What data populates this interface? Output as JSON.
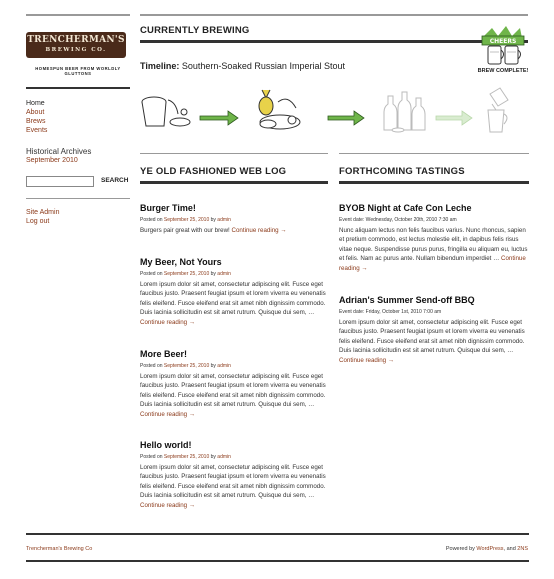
{
  "brand": {
    "name_line1": "TRENCHERMAN'S",
    "name_line2": "BREWING CO.",
    "tagline": "HOMESPUN BEER FROM WORLDLY GLUTTONS"
  },
  "nav": {
    "items": [
      "Home",
      "About",
      "Brews",
      "Events"
    ]
  },
  "archives": {
    "title": "Historical Archives",
    "link": "September 2010"
  },
  "search": {
    "value": "",
    "button_label": "SEARCH"
  },
  "meta": {
    "links": [
      "Site Admin",
      "Log out"
    ]
  },
  "current": {
    "heading": "CURRENTLY BREWING",
    "timeline_label": "Timeline:",
    "timeline_value": "Southern-Soaked Russian Imperial Stout",
    "cheers_text": "CHEERS",
    "complete_label": "BREW COMPLETE!"
  },
  "weblog": {
    "heading": "YE OLD FASHIONED WEB LOG",
    "posts": [
      {
        "title": "Burger Time!",
        "meta_prefix": "Posted on",
        "date": "September 25, 2010",
        "meta_by": "by",
        "author": "admin",
        "body": "Burgers pair great with our brew!",
        "more": "Continue reading →"
      },
      {
        "title": "My Beer, Not Yours",
        "meta_prefix": "Posted on",
        "date": "September 25, 2010",
        "meta_by": "by",
        "author": "admin",
        "body": "Lorem ipsum dolor sit amet, consectetur adipiscing elit. Fusce eget faucibus justo. Praesent feugiat ipsum et lorem viverra eu venenatis felis eleifend. Fusce eleifend erat sit amet nibh dignissim commodo. Duis lacinia sollicitudin est sit amet rutrum. Quisque dui sem, …",
        "more": "Continue reading →"
      },
      {
        "title": "More Beer!",
        "meta_prefix": "Posted on",
        "date": "September 25, 2010",
        "meta_by": "by",
        "author": "admin",
        "body": "Lorem ipsum dolor sit amet, consectetur adipiscing elit. Fusce eget faucibus justo. Praesent feugiat ipsum et lorem viverra eu venenatis felis eleifend. Fusce eleifend erat sit amet nibh dignissim commodo. Duis lacinia sollicitudin est sit amet rutrum. Quisque dui sem, …",
        "more": "Continue reading →"
      },
      {
        "title": "Hello world!",
        "meta_prefix": "Posted on",
        "date": "September 25, 2010",
        "meta_by": "by",
        "author": "admin",
        "body": "Lorem ipsum dolor sit amet, consectetur adipiscing elit. Fusce eget faucibus justo. Praesent feugiat ipsum et lorem viverra eu venenatis felis eleifend. Fusce eleifend erat sit amet nibh dignissim commodo. Duis lacinia sollicitudin est sit amet rutrum. Quisque dui sem, …",
        "more": "Continue reading →"
      }
    ]
  },
  "tastings": {
    "heading": "FORTHCOMING TASTINGS",
    "events": [
      {
        "title": "BYOB Night at Cafe Con Leche",
        "date_line": "Event date: Wednesday, October 20th, 2010 7:30 am",
        "body": "Nunc aliquam lectus non felis faucibus varius. Nunc rhoncus, sapien et pretium commodo, est lectus molestie elit, in dapibus felis risus vitae neque. Suspendisse purus purus, fringilla eu aliquam eu, luctus et felis. Nam ac purus ante. Nullam bibendum imperdiet …",
        "more": "Continue reading →"
      },
      {
        "title": "Adrian's Summer Send-off BBQ",
        "date_line": "Event date: Friday, October 1st, 2010 7:00 am",
        "body": "Lorem ipsum dolor sit amet, consectetur adipiscing elit. Fusce eget faucibus justo. Praesent feugiat ipsum et lorem viverra eu venenatis felis eleifend. Fusce eleifend erat sit amet nibh dignissim commodo. Duis lacinia sollicitudin est sit amet rutrum. Quisque dui sem, …",
        "more": "Continue reading →"
      }
    ]
  },
  "footer": {
    "left": "Trencherman's Brewing Co",
    "powered_prefix": "Powered by",
    "powered_link": "WordPress",
    "and_text": ", and",
    "theme_link": "2NS"
  },
  "colors": {
    "link": "#8b3a1a",
    "progress_green": "#6fb54a",
    "logo_bg": "#4a2a1a"
  }
}
